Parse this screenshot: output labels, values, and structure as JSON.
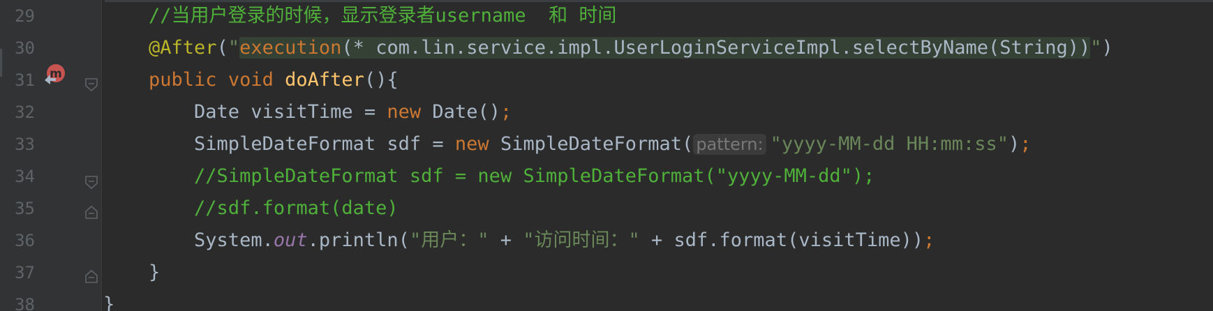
{
  "editor": {
    "line_numbers": [
      "29",
      "30",
      "31",
      "32",
      "33",
      "34",
      "35",
      "36",
      "37",
      "38"
    ],
    "lines": [
      {
        "tokens": [
          {
            "t": "    ",
            "c": "plain"
          },
          {
            "t": "//当用户登录的时候，显示登录者username  和 时间",
            "c": "cmt"
          }
        ]
      },
      {
        "tokens": [
          {
            "t": "    ",
            "c": "plain"
          },
          {
            "t": "@After",
            "c": "ann"
          },
          {
            "t": "(",
            "c": "plain"
          },
          {
            "t": "\"",
            "c": "str"
          },
          {
            "t": "execution",
            "c": "kw",
            "hl": true
          },
          {
            "t": "(* com.lin.service.impl.UserLoginServiceImpl.selectByName(String))",
            "c": "plain",
            "hl": true
          },
          {
            "t": "\"",
            "c": "str"
          },
          {
            "t": ")",
            "c": "plain"
          }
        ]
      },
      {
        "tokens": [
          {
            "t": "    ",
            "c": "plain"
          },
          {
            "t": "public",
            "c": "kw"
          },
          {
            "t": " ",
            "c": "plain"
          },
          {
            "t": "void",
            "c": "kw"
          },
          {
            "t": " ",
            "c": "plain"
          },
          {
            "t": "doAfter",
            "c": "fn"
          },
          {
            "t": "(){",
            "c": "plain"
          }
        ]
      },
      {
        "tokens": [
          {
            "t": "        Date visitTime = ",
            "c": "plain"
          },
          {
            "t": "new",
            "c": "kw"
          },
          {
            "t": " Date()",
            "c": "plain"
          },
          {
            "t": ";",
            "c": "kw"
          }
        ]
      },
      {
        "tokens": [
          {
            "t": "        SimpleDateFormat sdf = ",
            "c": "plain"
          },
          {
            "t": "new",
            "c": "kw"
          },
          {
            "t": " SimpleDateFormat(",
            "c": "plain"
          },
          {
            "t": "pattern:",
            "c": "hint"
          },
          {
            "t": "\"yyyy-MM-dd HH:mm:ss\"",
            "c": "str"
          },
          {
            "t": ")",
            "c": "plain"
          },
          {
            "t": ";",
            "c": "kw"
          }
        ]
      },
      {
        "tokens": [
          {
            "t": "        ",
            "c": "plain"
          },
          {
            "t": "//SimpleDateFormat sdf = new SimpleDateFormat(\"yyyy-MM-dd\");",
            "c": "cmt"
          }
        ]
      },
      {
        "tokens": [
          {
            "t": "        ",
            "c": "plain"
          },
          {
            "t": "//sdf.format(date)",
            "c": "cmt"
          }
        ]
      },
      {
        "tokens": [
          {
            "t": "        System.",
            "c": "plain"
          },
          {
            "t": "out",
            "c": "field"
          },
          {
            "t": ".println(",
            "c": "plain"
          },
          {
            "t": "\"用户：\"",
            "c": "str"
          },
          {
            "t": " + ",
            "c": "plain"
          },
          {
            "t": "\"访问时间：\"",
            "c": "str"
          },
          {
            "t": " + sdf.format(visitTime))",
            "c": "plain"
          },
          {
            "t": ";",
            "c": "kw"
          }
        ]
      },
      {
        "tokens": [
          {
            "t": "    }",
            "c": "plain"
          }
        ]
      },
      {
        "tokens": [
          {
            "t": "}",
            "c": "plain"
          }
        ]
      }
    ],
    "gutter_markers": {
      "method_marker_icon": "overriding-method-icon",
      "fold_icons": [
        "fold-start-icon",
        "fold-start-icon",
        "fold-end-icon",
        "fold-end-icon"
      ]
    },
    "colors": {
      "background": "#2b2b2b",
      "gutter": "#313335",
      "keyword": "#cc7832",
      "annotation": "#bbb529",
      "string": "#6a8759",
      "comment": "#4fb03a",
      "method": "#ffc66d",
      "field": "#9876aa",
      "text": "#a9b7c6",
      "line_number": "#606366",
      "highlight": "#344134",
      "marker": "#c75450"
    }
  }
}
